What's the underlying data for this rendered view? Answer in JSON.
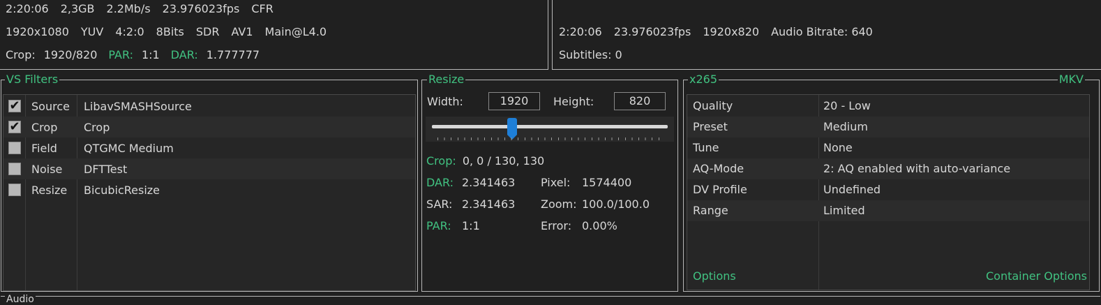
{
  "source_info": {
    "line1": [
      "2:20:06",
      "2,3GB",
      "2.2Mb/s",
      "23.976023fps",
      "CFR"
    ],
    "line2": [
      "1920x1080",
      "YUV",
      "4:2:0",
      "8Bits",
      "SDR",
      "AV1",
      "Main@L4.0"
    ],
    "crop_label": "Crop:",
    "crop_value": "1920/820",
    "par_label": "PAR:",
    "par_value": "1:1",
    "dar_label": "DAR:",
    "dar_value": "1.777777"
  },
  "output_info": {
    "line1": [
      "2:20:06",
      "23.976023fps",
      "1920x820",
      "Audio Bitrate: 640"
    ],
    "subtitles": "Subtitles: 0"
  },
  "vs_filters": {
    "title": "VS Filters",
    "rows": [
      {
        "checked": true,
        "name": "Source",
        "value": "LibavSMASHSource"
      },
      {
        "checked": true,
        "name": "Crop",
        "value": "Crop"
      },
      {
        "checked": false,
        "name": "Field",
        "value": "QTGMC Medium"
      },
      {
        "checked": false,
        "name": "Noise",
        "value": "DFTTest"
      },
      {
        "checked": false,
        "name": "Resize",
        "value": "BicubicResize"
      }
    ],
    "check_glyph": "✔"
  },
  "resize": {
    "title": "Resize",
    "width_label": "Width:",
    "width_value": "1920",
    "height_label": "Height:",
    "height_value": "820",
    "slider_fraction": 0.34,
    "crop_label": "Crop:",
    "crop_value": "0, 0 / 130, 130",
    "dar_label": "DAR:",
    "dar_value": "2.341463",
    "pixel_label": "Pixel:",
    "pixel_value": "1574400",
    "sar_label": "SAR:",
    "sar_value": "2.341463",
    "zoom_label": "Zoom:",
    "zoom_value": "100.0/100.0",
    "par_label": "PAR:",
    "par_value": "1:1",
    "error_label": "Error:",
    "error_value": "0.00%"
  },
  "encoder": {
    "title": "x265",
    "container_title": "MKV",
    "rows": [
      {
        "key": "Quality",
        "value": "20 - Low"
      },
      {
        "key": "Preset",
        "value": "Medium"
      },
      {
        "key": "Tune",
        "value": "None"
      },
      {
        "key": "AQ-Mode",
        "value": "2: AQ enabled with auto-variance"
      },
      {
        "key": "DV Profile",
        "value": "Undefined"
      },
      {
        "key": "Range",
        "value": "Limited"
      }
    ],
    "options_link": "Options",
    "container_options_link": "Container Options"
  },
  "audio": {
    "title": "Audio"
  },
  "colors": {
    "accent": "#41c281",
    "slider": "#1e7fd8",
    "background": "#202020"
  }
}
